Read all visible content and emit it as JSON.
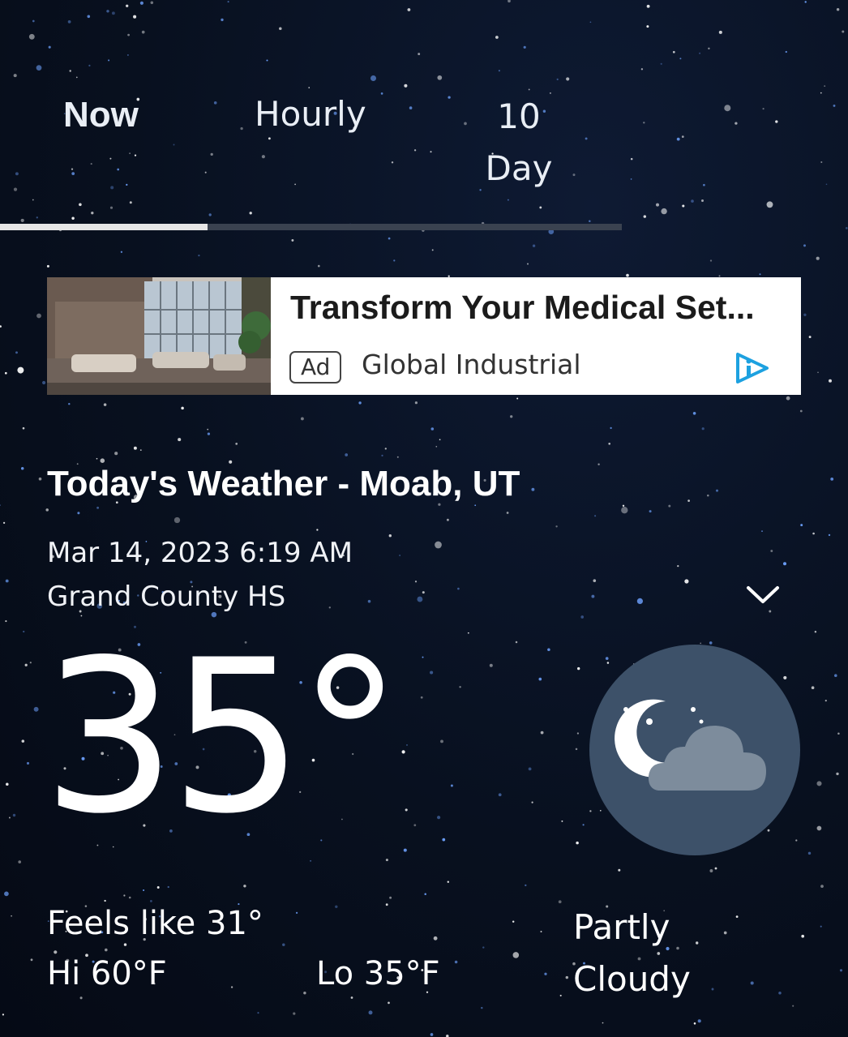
{
  "tabs": [
    {
      "label": "Now",
      "active": true
    },
    {
      "label": "Hourly",
      "active": false
    },
    {
      "label": "10 Day",
      "active": false
    }
  ],
  "ad": {
    "title": "Transform Your Medical Set...",
    "badge": "Ad",
    "advertiser": "Global Industrial",
    "choices_icon": "adchoices-icon",
    "image": "hospital-lobby-photo"
  },
  "weather": {
    "title": "Today's Weather - Moab, UT",
    "datetime": "Mar 14, 2023 6:19 AM",
    "station": "Grand County HS",
    "temperature": "35°",
    "feels_like": "Feels like 31°",
    "hi": "Hi 60°F",
    "lo": "Lo 35°F",
    "condition": "Partly Cloudy",
    "condition_icon": "moon-cloud-icon",
    "expand_icon": "chevron-down-icon"
  },
  "colors": {
    "background": "#08101f",
    "icon_circle": "#3d5169",
    "tab_indicator": "#e6e6e6",
    "tab_track": "#3a4250"
  }
}
